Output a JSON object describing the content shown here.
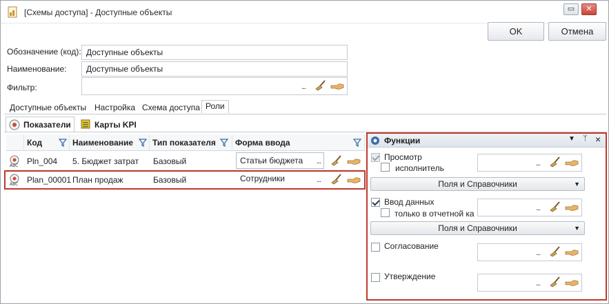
{
  "window": {
    "title": "[Схемы доступа] - Доступные объекты",
    "ok_label": "OK",
    "cancel_label": "Отмена"
  },
  "form": {
    "code_label": "Обозначение (код):",
    "code_value": "Доступные объекты",
    "name_label": "Наименование:",
    "name_value": "Доступные объекты",
    "filter_label": "Фильтр:",
    "filter_value": "",
    "ellipsis": "..."
  },
  "tabs": [
    {
      "label": "Доступные объекты"
    },
    {
      "label": "Настройка"
    },
    {
      "label": "Схема доступа"
    },
    {
      "label": "Роли"
    }
  ],
  "subtabs": [
    {
      "label": "Показатели"
    },
    {
      "label": "Карты KPI"
    }
  ],
  "grid": {
    "columns": [
      "Код",
      "Наименование",
      "Тип показателя",
      "Форма ввода"
    ],
    "rows": [
      {
        "code": "Pln_004",
        "name": "5. Бюджет затрат",
        "type": "Базовый",
        "form": "Статьи бюджета"
      },
      {
        "code": "Plan_00001",
        "name": "План продаж",
        "type": "Базовый",
        "form": "Сотрудники"
      }
    ]
  },
  "functions": {
    "title": "Функции",
    "pin": "ᛘ",
    "close": "×",
    "view_label": "Просмотр",
    "executor_label": "исполнитель",
    "fields_combo": "Поля и Справочники",
    "data_entry_label": "Ввод данных",
    "only_report_label": "только в отчетной ка",
    "approval_label": "Согласование",
    "confirmation_label": "Утверждение"
  },
  "colors": {
    "highlight": "#c0392b",
    "accent": "#3b6ea5"
  }
}
